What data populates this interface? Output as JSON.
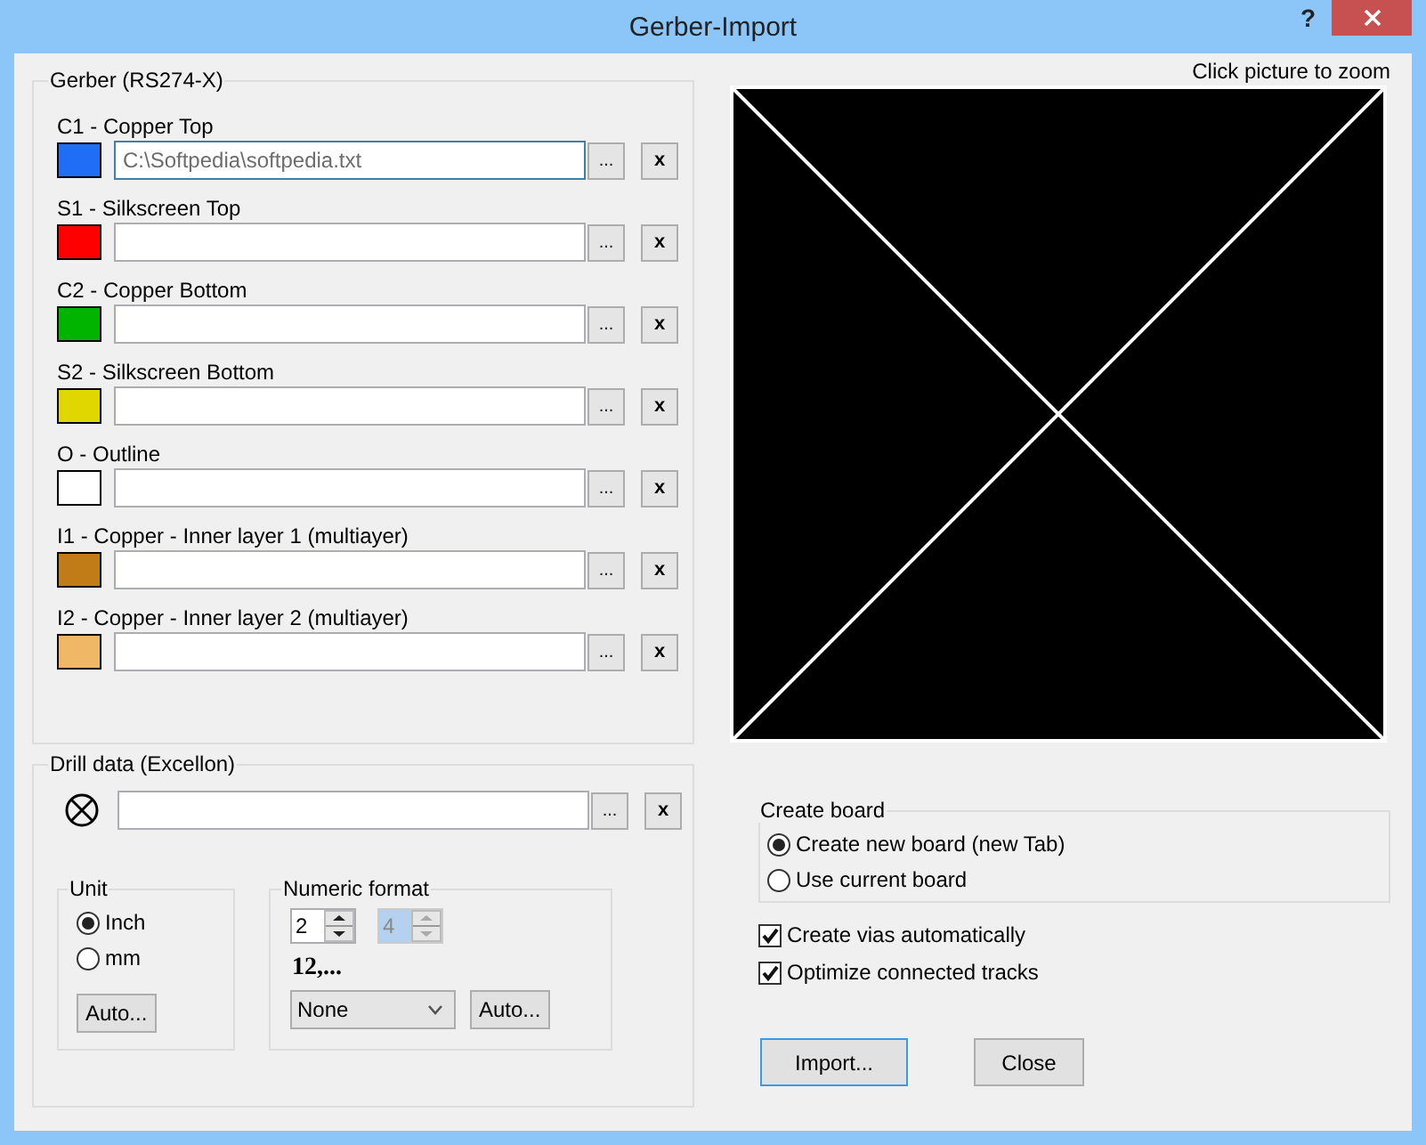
{
  "window": {
    "title": "Gerber-Import",
    "help_button": "?"
  },
  "gerber": {
    "title": "Gerber (RS274-X)",
    "layers": [
      {
        "label": "C1 - Copper Top",
        "color": "#1f6ef5",
        "value": "C:\\Softpedia\\softpedia.txt",
        "focused": true,
        "browse": "...",
        "clear": "x"
      },
      {
        "label": "S1 - Silkscreen Top",
        "color": "#ff0000",
        "focused": false,
        "browse": "...",
        "clear": "x"
      },
      {
        "label": "C2 - Copper Bottom",
        "color": "#00b400",
        "focused": false,
        "browse": "...",
        "clear": "x"
      },
      {
        "label": "S2 - Silkscreen Bottom",
        "color": "#e1d700",
        "focused": false,
        "browse": "...",
        "clear": "x"
      },
      {
        "label": "O - Outline",
        "color": "#ffffff",
        "focused": false,
        "browse": "...",
        "clear": "x"
      },
      {
        "label": "I1 - Copper - Inner layer 1 (multiayer)",
        "color": "#c17c17",
        "focused": false,
        "browse": "...",
        "clear": "x"
      },
      {
        "label": "I2 - Copper - Inner layer 2 (multiayer)",
        "color": "#efb866",
        "focused": false,
        "browse": "...",
        "clear": "x"
      }
    ]
  },
  "drill": {
    "title": "Drill data (Excellon)",
    "browse": "...",
    "clear": "x",
    "unit": {
      "title": "Unit",
      "options": [
        {
          "label": "Inch",
          "selected": true
        },
        {
          "label": "mm",
          "selected": false
        }
      ],
      "auto_button": "Auto..."
    },
    "numeric_format": {
      "title": "Numeric format",
      "spinners": [
        {
          "value": "2",
          "disabled": false
        },
        {
          "value": "4",
          "disabled": true
        }
      ],
      "sample": "12,...",
      "dropdown": "None",
      "auto_button": "Auto..."
    }
  },
  "preview": {
    "caption": "Click picture to zoom"
  },
  "create_board": {
    "title": "Create board",
    "options": [
      {
        "label": "Create new board (new Tab)",
        "selected": true
      },
      {
        "label": "Use current board",
        "selected": false
      }
    ]
  },
  "options": [
    {
      "label": "Create vias automatically",
      "checked": true
    },
    {
      "label": "Optimize connected tracks",
      "checked": true
    }
  ],
  "buttons": [
    {
      "label": "Import...",
      "default": true
    },
    {
      "label": "Close",
      "default": false
    }
  ]
}
